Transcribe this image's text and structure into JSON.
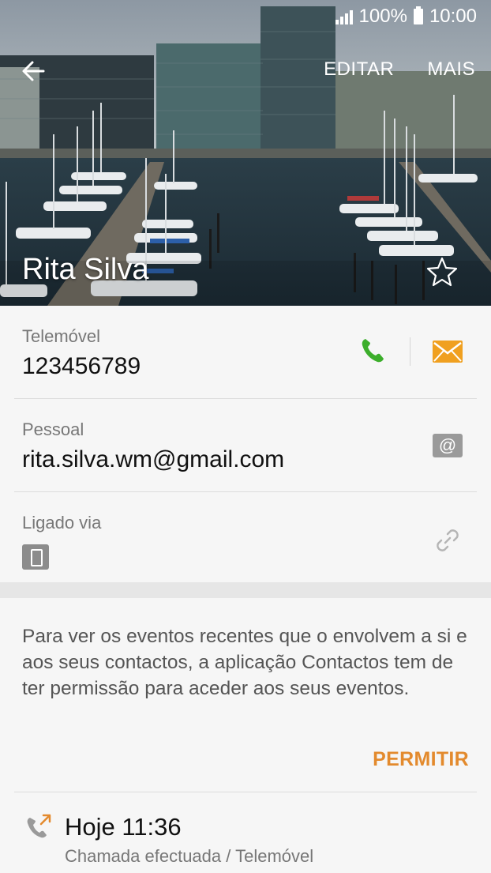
{
  "status_bar": {
    "battery": "100%",
    "time": "10:00"
  },
  "header": {
    "back_icon": "arrow-left-icon",
    "edit_label": "EDITAR",
    "more_label": "MAIS",
    "contact_name": "Rita Silva",
    "favorite_icon": "star-outline-icon"
  },
  "phone": {
    "label": "Telemóvel",
    "number": "123456789",
    "call_icon": "phone-icon",
    "message_icon": "envelope-icon"
  },
  "email": {
    "label": "Pessoal",
    "address": "rita.silva.wm@gmail.com",
    "email_icon": "at-icon"
  },
  "linked": {
    "label": "Ligado via",
    "device_icon": "device-icon",
    "link_icon": "link-icon"
  },
  "permission": {
    "text": "Para ver os eventos recentes que o envolvem a si e aos seus contactos, a aplicação Contactos tem de ter permissão para aceder aos seus eventos.",
    "button_label": "PERMITIR"
  },
  "call_log": {
    "icon": "outgoing-call-icon",
    "time": "Hoje 11:36",
    "detail": "Chamada efectuada / Telemóvel"
  },
  "colors": {
    "accent": "#e38a2d",
    "call_green": "#3cae2b",
    "mail_orange": "#f0a020"
  }
}
